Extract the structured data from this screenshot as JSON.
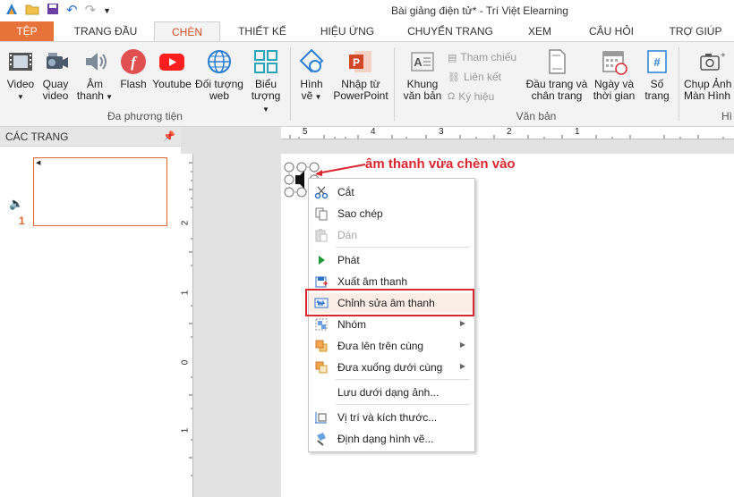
{
  "window": {
    "title": "Bài giảng điện tử* - Trí Việt Elearning"
  },
  "tabs": [
    "TỆP",
    "TRANG ĐẦU",
    "CHÈN",
    "THIẾT KẾ",
    "HIỆU ỨNG",
    "CHUYỂN TRANG",
    "XEM",
    "CÂU HỎI",
    "TRỢ GIÚP"
  ],
  "ribbon": {
    "media_buttons": {
      "video": "Video",
      "record_video": [
        "Quay",
        "video"
      ],
      "audio": [
        "Âm",
        "thanh"
      ],
      "flash": "Flash",
      "youtube": "Youtube",
      "web_object": [
        "Đối tượng",
        "web"
      ]
    },
    "media_group": "Đa phương tiện",
    "chart": [
      "Biểu",
      "tượng"
    ],
    "shapes": [
      "Hình",
      "vẽ"
    ],
    "import_ppt": [
      "Nhập từ",
      "PowerPoint"
    ],
    "textbox": [
      "Khung",
      "văn bản"
    ],
    "reference": "Tham chiếu",
    "link": "Liên kết",
    "symbol": "Ký hiệu",
    "header_footer": [
      "Đầu trang và",
      "chân trang"
    ],
    "datetime": [
      "Ngày và",
      "thời gian"
    ],
    "page_number": [
      "Số",
      "trang"
    ],
    "text_group": "Văn bản",
    "screenshot": [
      "Chụp Ảnh",
      "Màn Hình"
    ],
    "last_group_fragment": "Hì"
  },
  "slides_pane": {
    "title": "CÁC TRANG",
    "slide_number": "1"
  },
  "rulers": {
    "horizontal": [
      "5",
      "4",
      "3",
      "2",
      "1"
    ],
    "vertical": [
      "2",
      "1",
      "0",
      "1"
    ]
  },
  "annotation": "âm thanh vừa chèn vào",
  "context_menu": [
    {
      "label": "Cắt",
      "icon": "scissors-icon",
      "disabled": false
    },
    {
      "label": "Sao chép",
      "icon": "copy-icon",
      "disabled": false
    },
    {
      "label": "Dán",
      "icon": "paste-icon",
      "disabled": true
    },
    {
      "label": "Phát",
      "icon": "play-icon",
      "disabled": false
    },
    {
      "label": "Xuất âm thanh",
      "icon": "export-audio-icon",
      "disabled": false
    },
    {
      "label": "Chỉnh sửa âm thanh",
      "icon": "edit-audio-icon",
      "disabled": false
    },
    {
      "label": "Nhóm",
      "icon": "group-icon",
      "disabled": false,
      "submenu": true
    },
    {
      "label": "Đưa lên trên cùng",
      "icon": "bring-front-icon",
      "disabled": false,
      "submenu": true
    },
    {
      "label": "Đưa xuống dưới cùng",
      "icon": "send-back-icon",
      "disabled": false,
      "submenu": true
    },
    {
      "label": "Lưu dưới dạng ảnh...",
      "icon": "",
      "disabled": false
    },
    {
      "label": "Vị trí và kích thước...",
      "icon": "position-size-icon",
      "disabled": false
    },
    {
      "label": "Định dạng hình vẽ...",
      "icon": "format-shape-icon",
      "disabled": false
    }
  ],
  "colors": {
    "accent": "#e8733a",
    "highlight": "#d9282f"
  }
}
